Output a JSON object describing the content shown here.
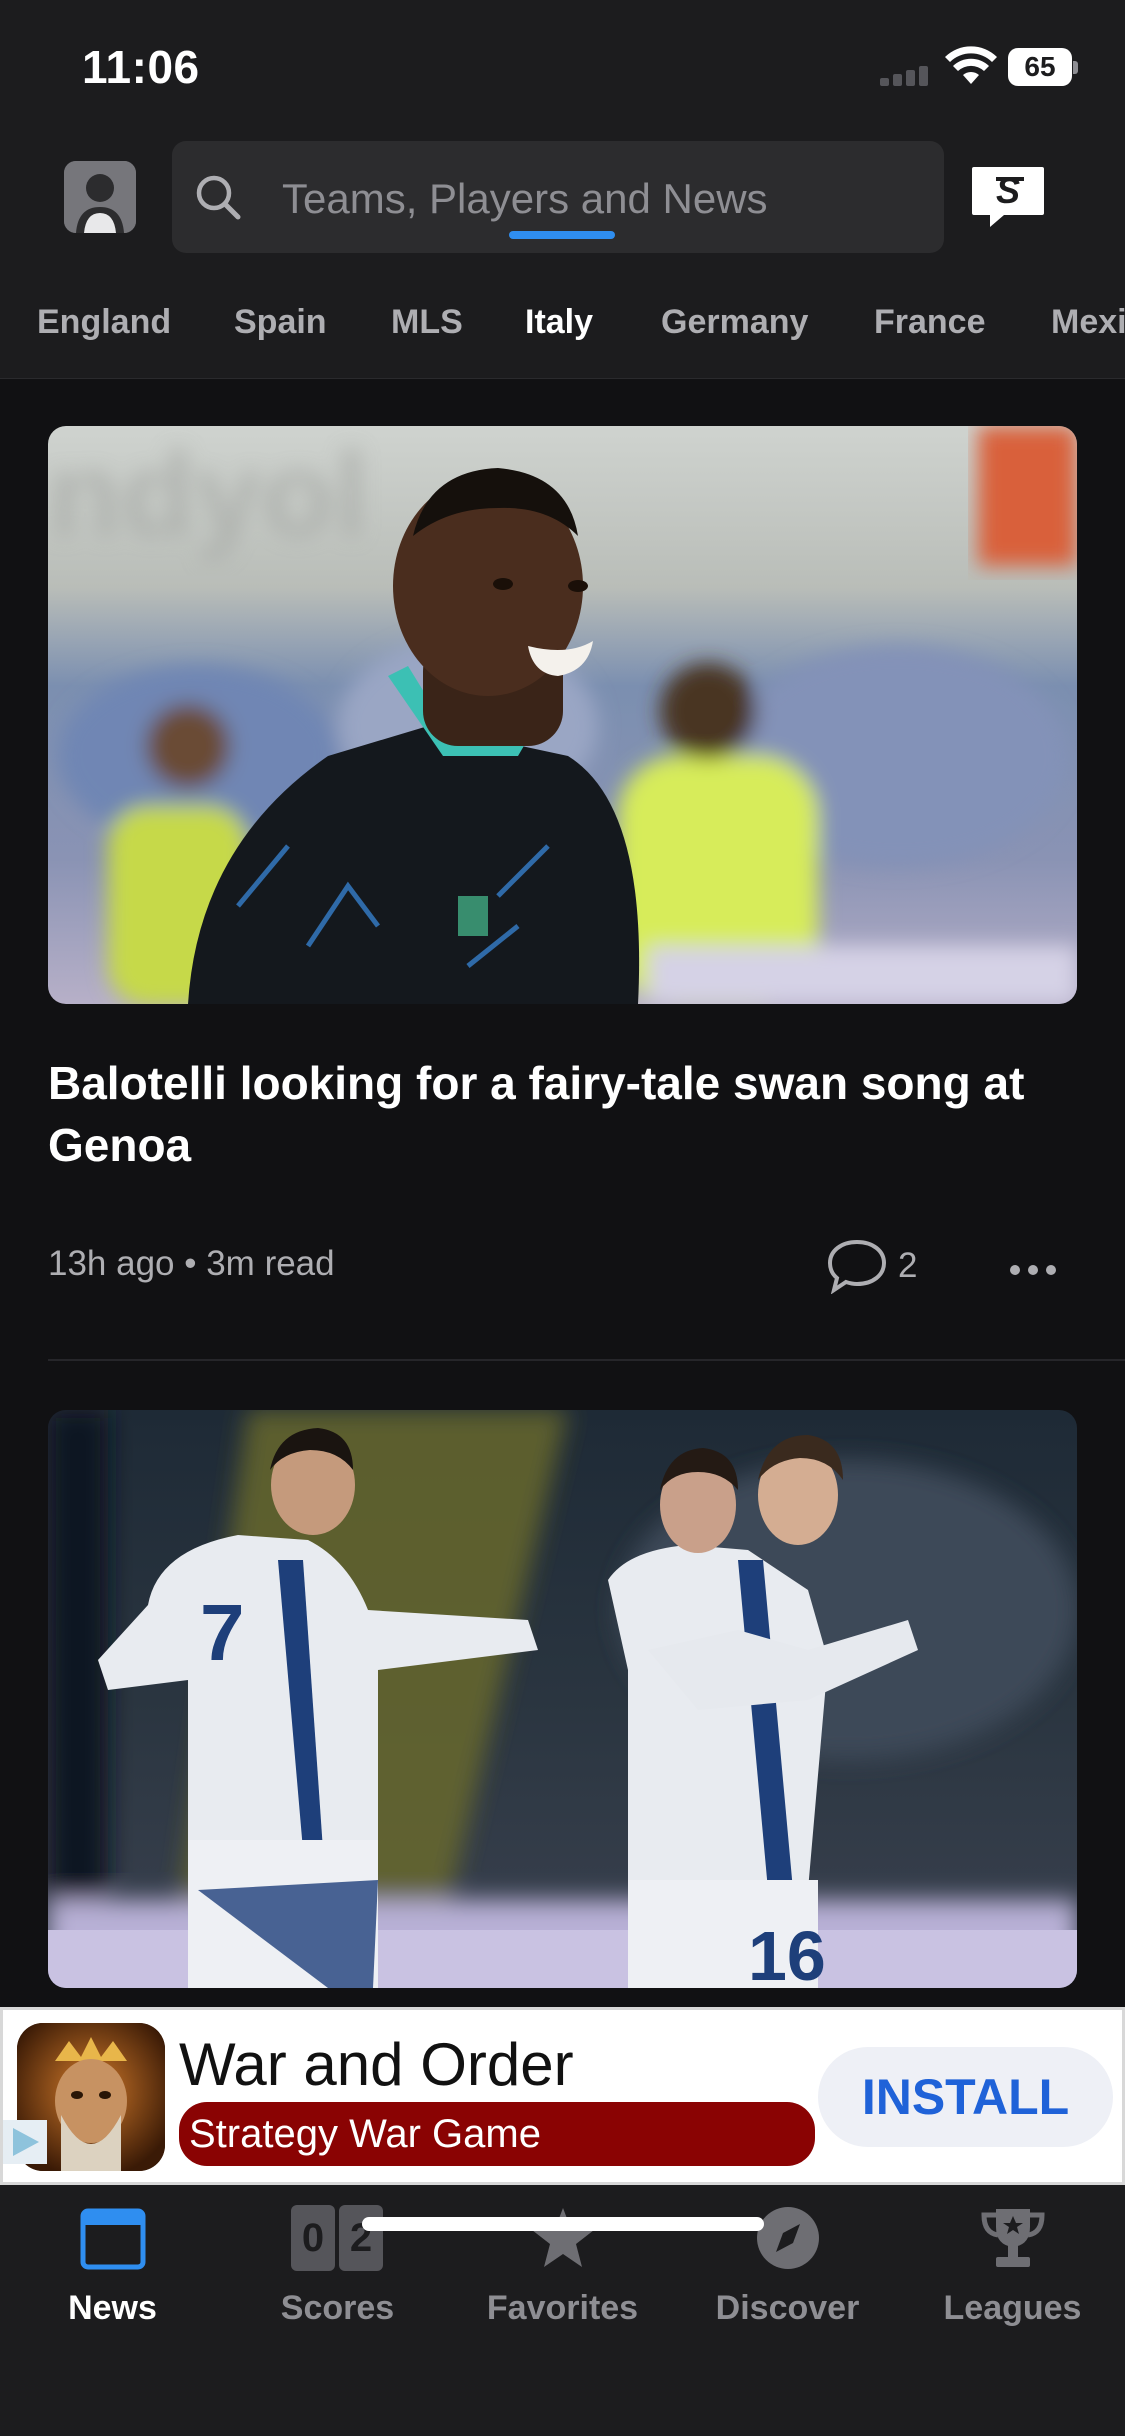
{
  "status_bar": {
    "time": "11:06",
    "battery": "65"
  },
  "header": {
    "search_placeholder": "Teams, Players and News",
    "tabs": [
      {
        "label": "England"
      },
      {
        "label": "Spain"
      },
      {
        "label": "MLS"
      },
      {
        "label": "Italy",
        "active": true
      },
      {
        "label": "Germany"
      },
      {
        "label": "France"
      },
      {
        "label": "Mexi"
      }
    ]
  },
  "feed": {
    "articles": [
      {
        "title": "Balotelli looking for a fairy-tale swan song at Genoa",
        "meta": "13h ago • 3m read",
        "comment_count": "2"
      }
    ]
  },
  "ad": {
    "title": "War and Order",
    "subtitle": "Strategy War Game",
    "cta": "INSTALL"
  },
  "bottom_nav": {
    "items": [
      {
        "label": "News",
        "icon": "news-icon",
        "active": true
      },
      {
        "label": "Scores",
        "icon": "scores-icon",
        "score_left": "0",
        "score_right": "2"
      },
      {
        "label": "Favorites",
        "icon": "star-icon"
      },
      {
        "label": "Discover",
        "icon": "compass-icon"
      },
      {
        "label": "Leagues",
        "icon": "trophy-icon"
      }
    ]
  },
  "colors": {
    "accent": "#2f8ef0",
    "background": "#111113",
    "bar": "#1c1c1e",
    "ad_red": "#8a0303"
  }
}
